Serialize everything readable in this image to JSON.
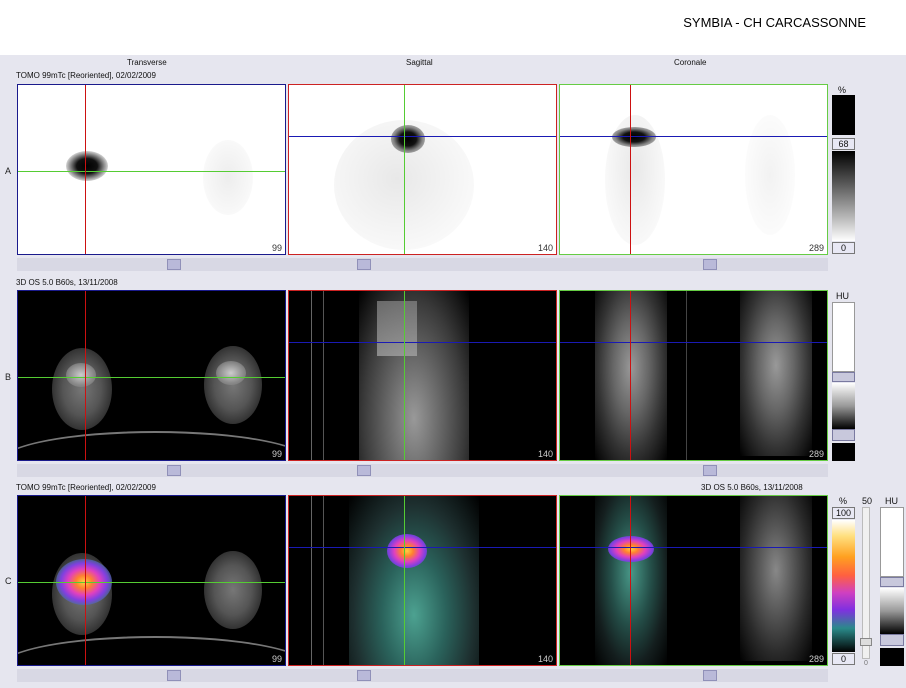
{
  "app": {
    "title": "SYMBIA - CH CARCASSONNE"
  },
  "columns": {
    "transverse": "Transverse",
    "sagittal": "Sagittal",
    "coronal": "Coronale"
  },
  "rows": {
    "a": {
      "label": "A",
      "series": "TOMO 99mTc [Reoriented], 02/02/2009",
      "slices": [
        "99",
        "140",
        "289"
      ]
    },
    "b": {
      "label": "B",
      "series": "3D  OS  5.0  B60s, 13/11/2008",
      "slices": [
        "99",
        "140",
        "289"
      ]
    },
    "c": {
      "label": "C",
      "series_left": "TOMO 99mTc [Reoriented], 02/02/2009",
      "series_right": "3D  OS  5.0  B60s, 13/11/2008",
      "slices": [
        "99",
        "140",
        "289"
      ]
    }
  },
  "colorbars": {
    "a": {
      "unit": "%",
      "value": "68",
      "min": "0"
    },
    "b": {
      "unit": "HU"
    },
    "c": {
      "unit_pct": "%",
      "max": "100",
      "min": "0",
      "slider_top": "50",
      "slider_bottom": "0",
      "unit_hu": "HU"
    }
  },
  "colors": {
    "transverse_border": "#1a1a8c",
    "sagittal_border": "#cc2222",
    "coronal_border": "#66cc44",
    "crosshair_red": "#cc1111",
    "crosshair_green": "#55cc33",
    "crosshair_blue": "#1a1ab4"
  }
}
